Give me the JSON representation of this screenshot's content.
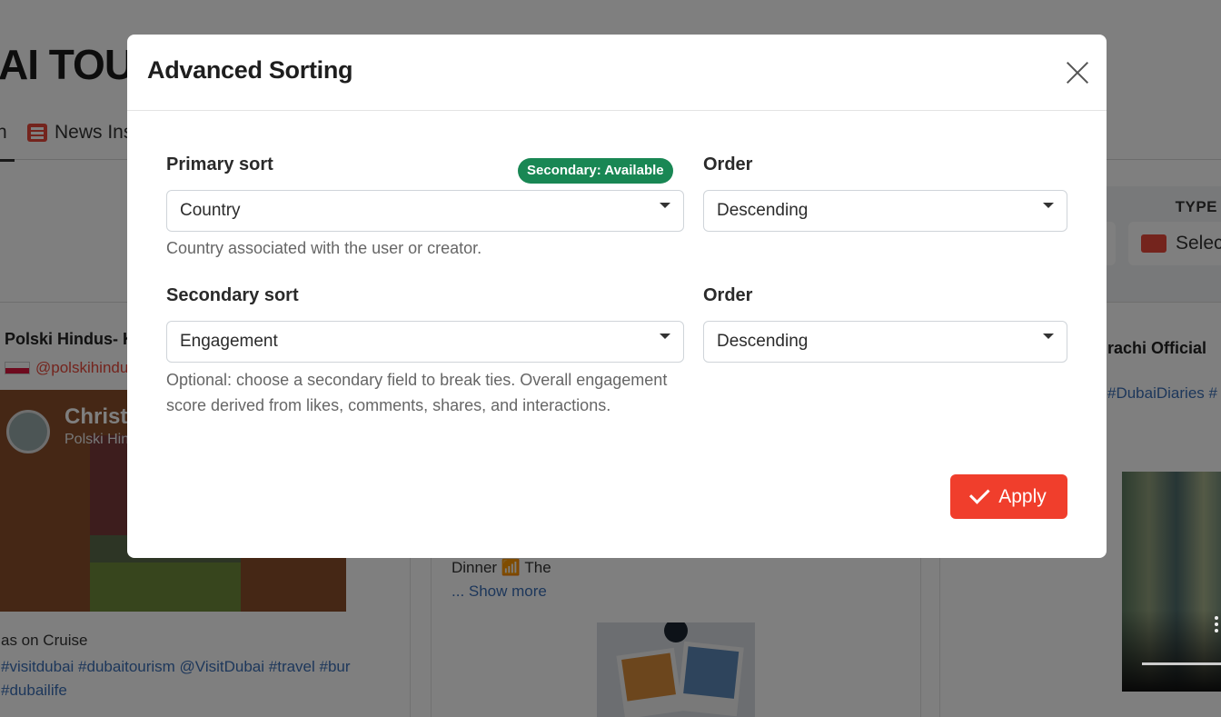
{
  "background": {
    "title": "AI TOU",
    "tabs": {
      "active_label": "n",
      "news_label": "News Ins"
    },
    "filter": {
      "type_label": "TYPE",
      "type_select_value": "Selec"
    },
    "cards": [
      {
        "name": "Polski Hindus- K",
        "handle": "@polskihindu",
        "overlay_name": "Christ",
        "overlay_sub": "Polski Hin",
        "caption": "as on Cruise",
        "tags": "#visitdubai #dubaitourism @VisitDubai #travel #bur #dubailife"
      },
      {
        "text": "Dinner 📶 The",
        "show_more": "... Show more"
      },
      {
        "name": "rachi Official",
        "tags": "#DubaiDiaries #"
      }
    ]
  },
  "modal": {
    "title": "Advanced Sorting",
    "primary": {
      "label": "Primary sort",
      "badge": "Secondary: Available",
      "value": "Country",
      "help": "Country associated with the user or creator.",
      "order_label": "Order",
      "order_value": "Descending"
    },
    "secondary": {
      "label": "Secondary sort",
      "value": "Engagement",
      "help": "Optional: choose a secondary field to break ties. Overall engagement score derived from likes, comments, shares, and interactions.",
      "order_label": "Order",
      "order_value": "Descending"
    },
    "apply_label": "Apply"
  },
  "colors": {
    "accent": "#f03e2c",
    "badge": "#198754",
    "link": "#3b6fb6"
  }
}
